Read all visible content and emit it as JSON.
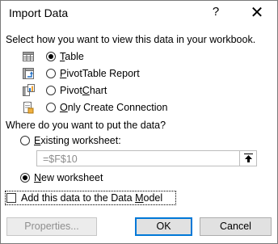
{
  "dialog": {
    "title": "Import Data",
    "help_glyph": "?",
    "close_glyph": "✕"
  },
  "view": {
    "prompt": "Select how you want to view this data in your workbook.",
    "options": [
      {
        "label_u": "T",
        "label_rest": "able",
        "selected": true,
        "icon": "table-icon"
      },
      {
        "label_u": "P",
        "label_rest": "ivotTable Report",
        "selected": false,
        "icon": "pivottable-icon"
      },
      {
        "label_pre": "Pivot",
        "label_u": "C",
        "label_rest": "hart",
        "selected": false,
        "icon": "pivotchart-icon"
      },
      {
        "label_u": "O",
        "label_rest": "nly Create Connection",
        "selected": false,
        "icon": "connection-icon"
      }
    ]
  },
  "destination": {
    "prompt": "Where do you want to put the data?",
    "existing": {
      "label_u": "E",
      "label_rest": "xisting worksheet:",
      "selected": false
    },
    "reference": {
      "value": "=$F$10"
    },
    "new": {
      "label_u": "N",
      "label_rest": "ew worksheet",
      "selected": true
    }
  },
  "datamodel": {
    "label_pre": "Add this data to the Data ",
    "label_u": "M",
    "label_rest": "odel",
    "checked": false
  },
  "buttons": {
    "properties_label": "Properties...",
    "ok_label": "OK",
    "cancel_label": "Cancel"
  },
  "colors": {
    "accent": "#0078d7",
    "disabled_text": "#8f8f8f",
    "button_face": "#e1e1e1"
  }
}
